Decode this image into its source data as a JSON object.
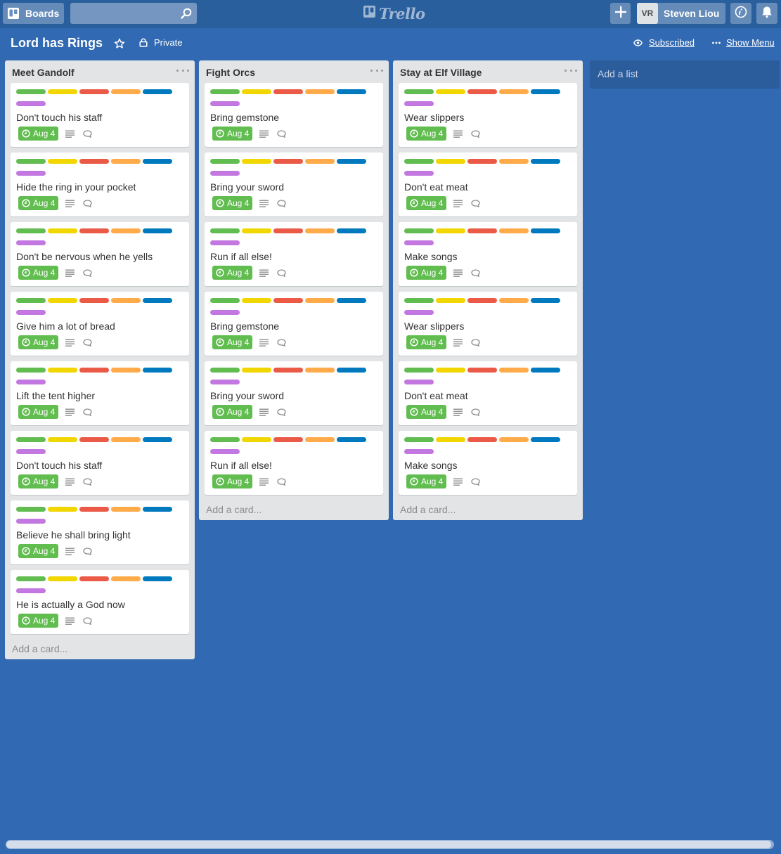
{
  "header": {
    "boards_label": "Boards",
    "search_placeholder": "",
    "logo_text": "Trello",
    "user_initials": "VR",
    "user_name": "Steven Liou"
  },
  "board": {
    "title": "Lord has Rings",
    "privacy": "Private",
    "subscribed": "Subscribed",
    "show_menu": "Show Menu"
  },
  "add_list_label": "Add a list",
  "add_card_label": "Add a card...",
  "label_colors": {
    "green": "#61bd4f",
    "yellow": "#f2d600",
    "red": "#eb5a46",
    "orange": "#ffab4a",
    "blue": "#0079bf",
    "purple": "#c377e0"
  },
  "lists": [
    {
      "name": "Meet Gandolf",
      "cards": [
        {
          "title": "Don't touch his staff",
          "due": "Aug 4"
        },
        {
          "title": "Hide the ring in your pocket",
          "due": "Aug 4"
        },
        {
          "title": "Don't be nervous when he yells",
          "due": "Aug 4"
        },
        {
          "title": "Give him a lot of bread",
          "due": "Aug 4"
        },
        {
          "title": "Lift the tent higher",
          "due": "Aug 4"
        },
        {
          "title": "Don't touch his staff",
          "due": "Aug 4"
        },
        {
          "title": "Believe he shall bring light",
          "due": "Aug 4"
        },
        {
          "title": "He is actually a God now",
          "due": "Aug 4"
        }
      ]
    },
    {
      "name": "Fight Orcs",
      "cards": [
        {
          "title": "Bring gemstone",
          "due": "Aug 4"
        },
        {
          "title": "Bring your sword",
          "due": "Aug 4"
        },
        {
          "title": "Run if all else!",
          "due": "Aug 4"
        },
        {
          "title": "Bring gemstone",
          "due": "Aug 4"
        },
        {
          "title": "Bring your sword",
          "due": "Aug 4"
        },
        {
          "title": "Run if all else!",
          "due": "Aug 4"
        }
      ]
    },
    {
      "name": "Stay at Elf Village",
      "cards": [
        {
          "title": "Wear slippers",
          "due": "Aug 4"
        },
        {
          "title": "Don't eat meat",
          "due": "Aug 4"
        },
        {
          "title": "Make songs",
          "due": "Aug 4"
        },
        {
          "title": "Wear slippers",
          "due": "Aug 4"
        },
        {
          "title": "Don't eat meat",
          "due": "Aug 4"
        },
        {
          "title": "Make songs",
          "due": "Aug 4"
        }
      ]
    }
  ]
}
